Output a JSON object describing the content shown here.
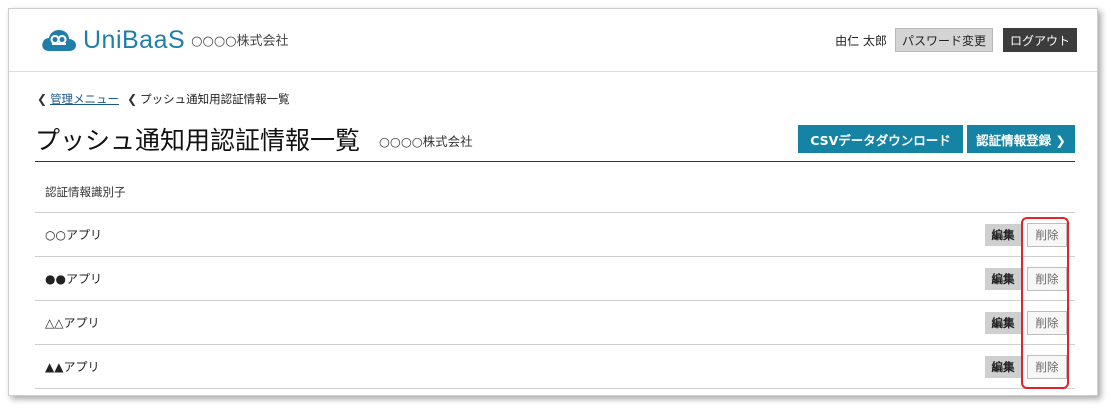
{
  "header": {
    "app_name": "UniBaaS",
    "company": "○○○○株式会社",
    "user_name": "由仁 太郎",
    "password_button": "パスワード変更",
    "logout_button": "ログアウト"
  },
  "breadcrumb": {
    "parent": "管理メニュー",
    "current": "プッシュ通知用認証情報一覧"
  },
  "page": {
    "title": "プッシュ通知用認証情報一覧",
    "company": "○○○○株式会社",
    "csv_button": "CSVデータダウンロード",
    "register_button": "認証情報登録 ❯"
  },
  "table": {
    "column_header": "認証情報識別子",
    "rows": [
      {
        "name": "○○アプリ",
        "edit": "編集",
        "delete": "削除"
      },
      {
        "name": "●●アプリ",
        "edit": "編集",
        "delete": "削除"
      },
      {
        "name": "△△アプリ",
        "edit": "編集",
        "delete": "削除"
      },
      {
        "name": "▲▲アプリ",
        "edit": "編集",
        "delete": "削除"
      }
    ]
  },
  "colors": {
    "brand": "#1f7fa8",
    "primary_button": "#1583a3",
    "highlight": "#e0252a"
  }
}
